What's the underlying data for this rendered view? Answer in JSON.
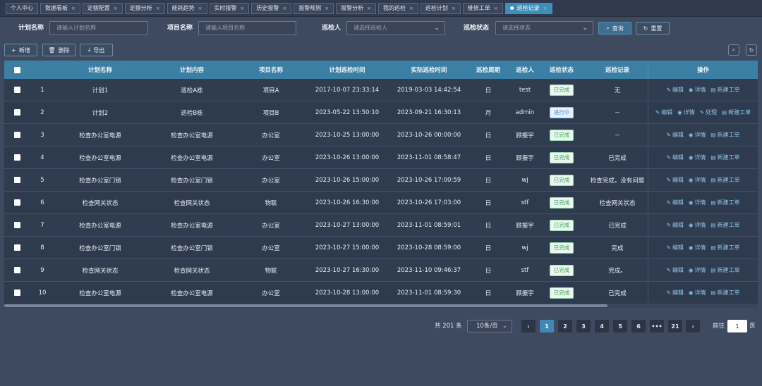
{
  "tabs": [
    {
      "label": "个人中心",
      "closable": false,
      "active": false
    },
    {
      "label": "数据看板",
      "closable": true,
      "active": false
    },
    {
      "label": "定额配置",
      "closable": true,
      "active": false
    },
    {
      "label": "定额分析",
      "closable": true,
      "active": false
    },
    {
      "label": "能耗趋势",
      "closable": true,
      "active": false
    },
    {
      "label": "实时报警",
      "closable": true,
      "active": false
    },
    {
      "label": "历史报警",
      "closable": true,
      "active": false
    },
    {
      "label": "报警规则",
      "closable": true,
      "active": false
    },
    {
      "label": "报警分析",
      "closable": true,
      "active": false
    },
    {
      "label": "我的巡检",
      "closable": true,
      "active": false
    },
    {
      "label": "巡检计划",
      "closable": true,
      "active": false
    },
    {
      "label": "维修工单",
      "closable": true,
      "active": false
    },
    {
      "label": "巡检记录",
      "closable": true,
      "active": true
    }
  ],
  "filters": {
    "plan_name_label": "计划名称",
    "plan_name_placeholder": "请输入计划名称",
    "project_name_label": "项目名称",
    "project_name_placeholder": "请输入项目名称",
    "inspector_label": "巡检人",
    "inspector_placeholder": "请选择巡检人",
    "status_label": "巡检状态",
    "status_placeholder": "请选择状态",
    "query_label": "查询",
    "reset_label": "重置"
  },
  "toolbar": {
    "add_label": "新增",
    "delete_label": "删除",
    "export_label": "导出"
  },
  "table": {
    "headers": {
      "plan_name": "计划名称",
      "plan_content": "计划内容",
      "project_name": "项目名称",
      "plan_time": "计划巡检时间",
      "actual_time": "实际巡检时间",
      "cycle": "巡检周期",
      "inspector": "巡检人",
      "status": "巡检状态",
      "record": "巡检记录",
      "actions": "操作"
    },
    "actions": {
      "edit": "编辑",
      "detail": "详情",
      "handle": "处理",
      "new_order": "新建工单"
    },
    "rows": [
      {
        "idx": "1",
        "plan_name": "计划1",
        "plan_content": "巡检A栋",
        "project_name": "项目A",
        "plan_time": "2017-10-07 23:33:14",
        "actual_time": "2019-03-03 14:42:54",
        "cycle": "日",
        "inspector": "test",
        "status": "已完成",
        "status_type": "done",
        "record": "无",
        "has_handle": false
      },
      {
        "idx": "2",
        "plan_name": "计划2",
        "plan_content": "巡检B栋",
        "project_name": "项目B",
        "plan_time": "2023-05-22 13:50:10",
        "actual_time": "2023-09-21 16:30:13",
        "cycle": "月",
        "inspector": "admin",
        "status": "进行中",
        "status_type": "prog",
        "record": "--",
        "has_handle": true
      },
      {
        "idx": "3",
        "plan_name": "检查办公室电源",
        "plan_content": "检查办公室电源",
        "project_name": "办公室",
        "plan_time": "2023-10-25 13:00:00",
        "actual_time": "2023-10-26 00:00:00",
        "cycle": "日",
        "inspector": "顾振宇",
        "status": "已完成",
        "status_type": "done",
        "record": "--",
        "has_handle": false
      },
      {
        "idx": "4",
        "plan_name": "检查办公室电源",
        "plan_content": "检查办公室电源",
        "project_name": "办公室",
        "plan_time": "2023-10-26 13:00:00",
        "actual_time": "2023-11-01 08:58:47",
        "cycle": "日",
        "inspector": "顾振宇",
        "status": "已完成",
        "status_type": "done",
        "record": "已完成",
        "has_handle": false
      },
      {
        "idx": "5",
        "plan_name": "检查办公室门锁",
        "plan_content": "检查办公室门锁",
        "project_name": "办公室",
        "plan_time": "2023-10-26 15:00:00",
        "actual_time": "2023-10-26 17:00:59",
        "cycle": "日",
        "inspector": "wj",
        "status": "已完成",
        "status_type": "done",
        "record": "检查完成，没有问题",
        "has_handle": false
      },
      {
        "idx": "6",
        "plan_name": "检查网关状态",
        "plan_content": "检查网关状态",
        "project_name": "物联",
        "plan_time": "2023-10-26 16:30:00",
        "actual_time": "2023-10-26 17:03:00",
        "cycle": "日",
        "inspector": "stf",
        "status": "已完成",
        "status_type": "done",
        "record": "检查网关状态",
        "has_handle": false
      },
      {
        "idx": "7",
        "plan_name": "检查办公室电源",
        "plan_content": "检查办公室电源",
        "project_name": "办公室",
        "plan_time": "2023-10-27 13:00:00",
        "actual_time": "2023-11-01 08:59:01",
        "cycle": "日",
        "inspector": "顾振宇",
        "status": "已完成",
        "status_type": "done",
        "record": "已完成",
        "has_handle": false
      },
      {
        "idx": "8",
        "plan_name": "检查办公室门锁",
        "plan_content": "检查办公室门锁",
        "project_name": "办公室",
        "plan_time": "2023-10-27 15:00:00",
        "actual_time": "2023-10-28 08:59:00",
        "cycle": "日",
        "inspector": "wj",
        "status": "已完成",
        "status_type": "done",
        "record": "完成",
        "has_handle": false
      },
      {
        "idx": "9",
        "plan_name": "检查网关状态",
        "plan_content": "检查网关状态",
        "project_name": "物联",
        "plan_time": "2023-10-27 16:30:00",
        "actual_time": "2023-11-10 09:46:37",
        "cycle": "日",
        "inspector": "stf",
        "status": "已完成",
        "status_type": "done",
        "record": "完成。",
        "has_handle": false
      },
      {
        "idx": "10",
        "plan_name": "检查办公室电源",
        "plan_content": "检查办公室电源",
        "project_name": "办公室",
        "plan_time": "2023-10-28 13:00:00",
        "actual_time": "2023-11-01 08:59:30",
        "cycle": "日",
        "inspector": "顾振宇",
        "status": "已完成",
        "status_type": "done",
        "record": "已完成",
        "has_handle": false
      }
    ]
  },
  "pagination": {
    "total": "共 201 条",
    "page_size": "10条/页",
    "pages": [
      "1",
      "2",
      "3",
      "4",
      "5",
      "6",
      "•••",
      "21"
    ],
    "current": "1",
    "goto_label": "前往",
    "goto_value": "1",
    "goto_unit": "页"
  },
  "colors": {
    "background": "#3e4a60",
    "header": "#3c7fa4",
    "accent": "#3f8ab4",
    "done": "#3aa35e",
    "progress": "#3b86cc"
  }
}
